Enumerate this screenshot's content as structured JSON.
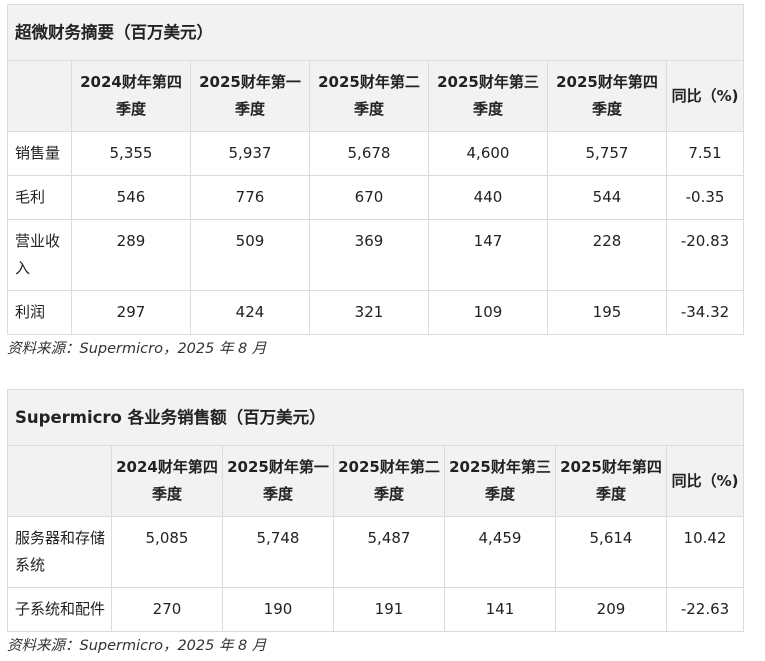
{
  "table1": {
    "title": "超微财务摘要（百万美元）",
    "headers": [
      "",
      "2024财年第四季度",
      "2025财年第一季度",
      "2025财年第二季度",
      "2025财年第三季度",
      "2025财年第四季度",
      "同比（%)"
    ],
    "rows": [
      [
        "销售量",
        "5,355",
        "5,937",
        "5,678",
        "4,600",
        "5,757",
        "7.51"
      ],
      [
        "毛利",
        "546",
        "776",
        "670",
        "440",
        "544",
        "-0.35"
      ],
      [
        "营业收入",
        "289",
        "509",
        "369",
        "147",
        "228",
        "-20.83"
      ],
      [
        "利润",
        "297",
        "424",
        "321",
        "109",
        "195",
        "-34.32"
      ]
    ],
    "source": "资料来源：Supermicro，2025 年 8 月"
  },
  "table2": {
    "title": "Supermicro 各业务销售额（百万美元）",
    "headers": [
      "",
      "2024财年第四季度",
      "2025财年第一季度",
      "2025财年第二季度",
      "2025财年第三季度",
      "2025财年第四季度",
      "同比（%)"
    ],
    "rows": [
      [
        "服务器和存储系统",
        "5,085",
        "5,748",
        "5,487",
        "4,459",
        "5,614",
        "10.42"
      ],
      [
        "子系统和配件",
        "270",
        "190",
        "191",
        "141",
        "209",
        "-22.63"
      ]
    ],
    "source": "资料来源：Supermicro，2025 年 8 月"
  }
}
